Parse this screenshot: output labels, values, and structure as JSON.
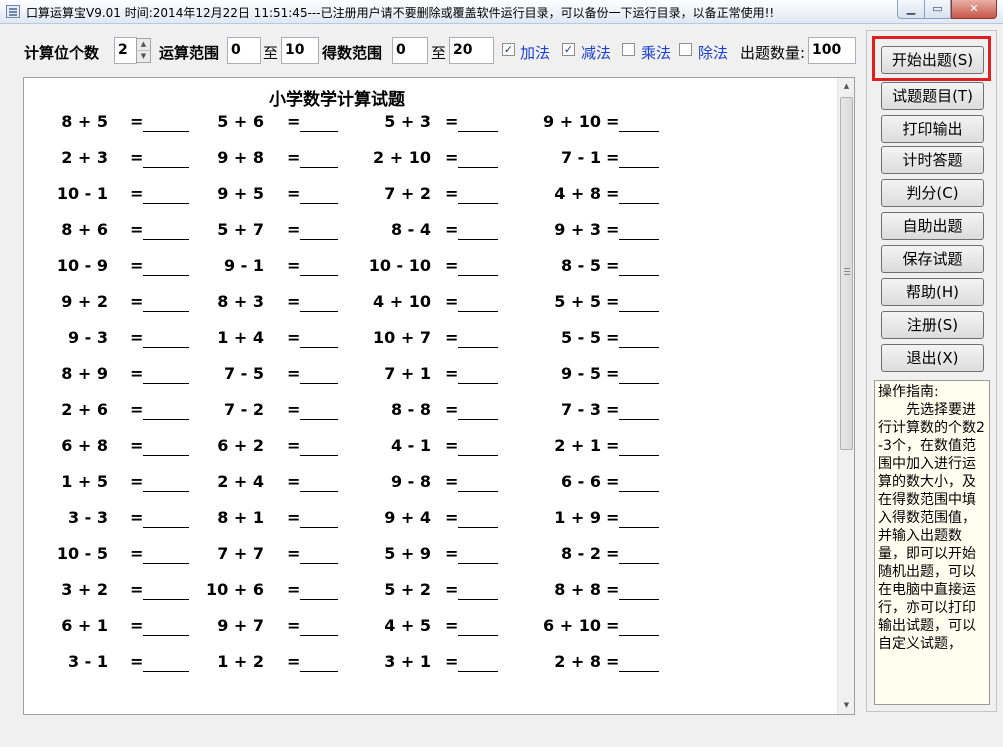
{
  "window": {
    "title": "口算运算宝V9.01  时间:2014年12月22日  11:51:45---已注册用户请不要删除或覆盖软件运行目录，可以备份一下运行目录，以备正常使用!!",
    "min_glyph": "▁",
    "max_glyph": "▭",
    "close_glyph": "✕"
  },
  "settings": {
    "digits_label": "计算位个数",
    "digits_value": "2",
    "range_label": "运算范围",
    "range_from": "0",
    "to_label_1": "至",
    "range_to": "10",
    "result_label": "得数范围",
    "result_from": "0",
    "to_label_2": "至",
    "result_to": "20",
    "add_label": "加法",
    "add_checked": true,
    "sub_label": "减法",
    "sub_checked": true,
    "mul_label": "乘法",
    "mul_checked": false,
    "div_label": "除法",
    "div_checked": false,
    "count_label": "出题数量:",
    "count_value": "100"
  },
  "paper": {
    "title": "小学数学计算试题",
    "equals": "=",
    "rows": [
      [
        "8 + 5",
        "5 + 6",
        "5 + 3",
        "9 + 10"
      ],
      [
        "2 + 3",
        "9 + 8",
        "2 + 10",
        "7 - 1"
      ],
      [
        "10 - 1",
        "9 + 5",
        "7 + 2",
        "4 + 8"
      ],
      [
        "8 + 6",
        "5 + 7",
        "8 - 4",
        "9 + 3"
      ],
      [
        "10 - 9",
        "9 - 1",
        "10 - 10",
        "8 - 5"
      ],
      [
        "9 + 2",
        "8 + 3",
        "4 + 10",
        "5 + 5"
      ],
      [
        "9 - 3",
        "1 + 4",
        "10 + 7",
        "5 - 5"
      ],
      [
        "8 + 9",
        "7 - 5",
        "7 + 1",
        "9 - 5"
      ],
      [
        "2 + 6",
        "7 - 2",
        "8 - 8",
        "7 - 3"
      ],
      [
        "6 + 8",
        "6 + 2",
        "4 - 1",
        "2 + 1"
      ],
      [
        "1 + 5",
        "2 + 4",
        "9 - 8",
        "6 - 6"
      ],
      [
        "3 - 3",
        "8 + 1",
        "9 + 4",
        "1 + 9"
      ],
      [
        "10 - 5",
        "7 + 7",
        "5 + 9",
        "8 - 2"
      ],
      [
        "3 + 2",
        "10 + 6",
        "5 + 2",
        "8 + 8"
      ],
      [
        "6 + 1",
        "9 + 7",
        "4 + 5",
        "6 + 10"
      ],
      [
        "3 - 1",
        "1 + 2",
        "3 + 1",
        "2 + 8"
      ]
    ]
  },
  "buttons": {
    "start": "开始出题(S)",
    "quiz": "试题题目(T)",
    "print": "打印输出",
    "timed": "计时答题",
    "score": "判分(C)",
    "custom": "自助出题",
    "save": "保存试题",
    "help": "帮助(H)",
    "register": "注册(S)",
    "exit": "退出(X)"
  },
  "guide": {
    "head": "操作指南:",
    "body": "先选择要进行计算数的个数2-3个，在数值范围中加入进行运算的数大小，及在得数范围中填入得数范围值，并输入出题数量，即可以开始随机出题，可以在电脑中直接运行，亦可以打印输出试题，可以自定义试题，"
  }
}
